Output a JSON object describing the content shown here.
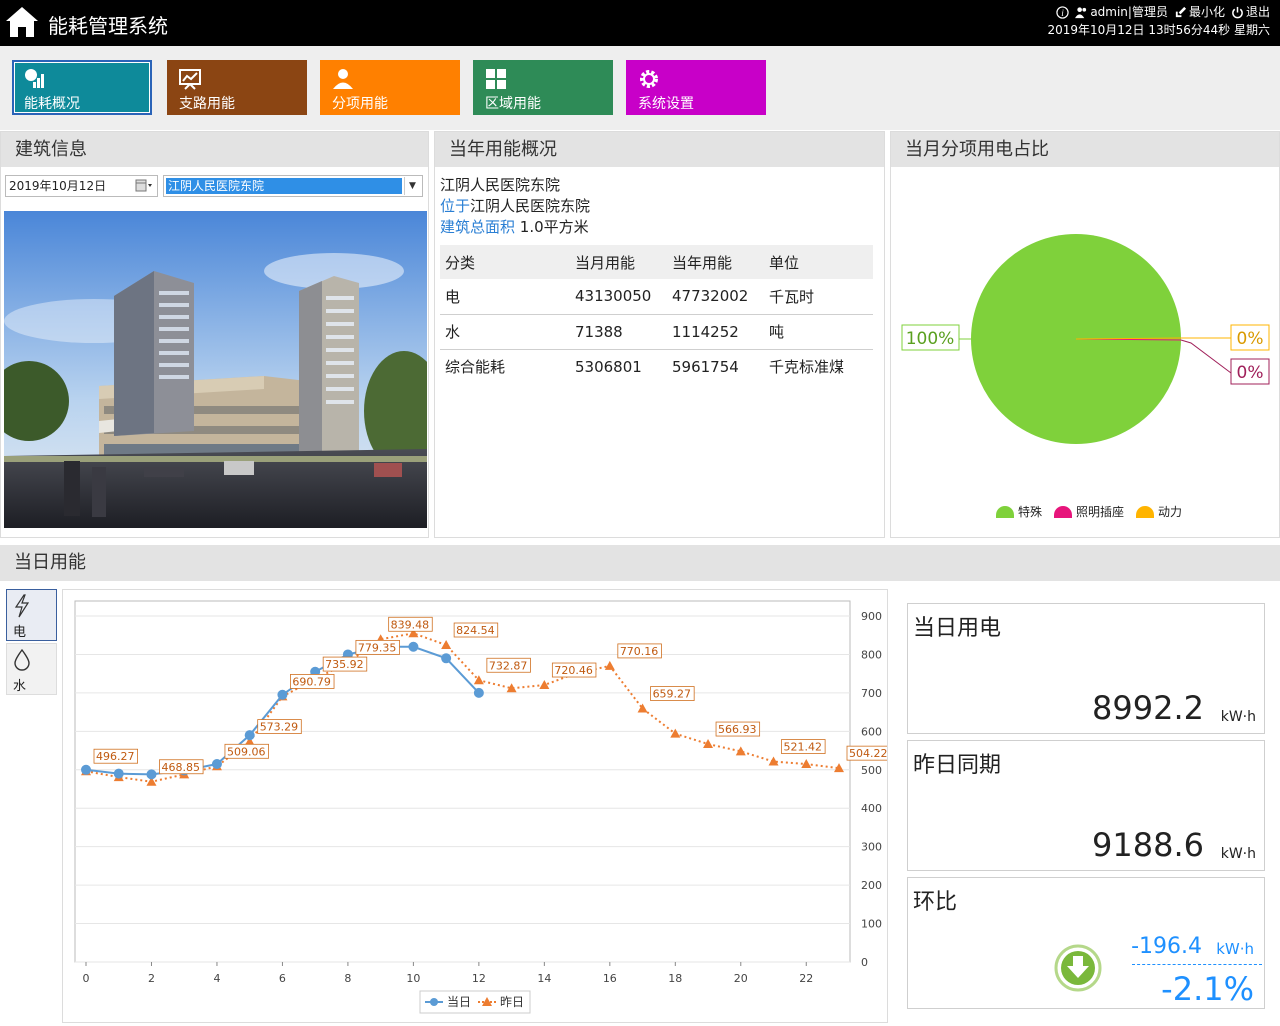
{
  "header": {
    "title": "能耗管理系统",
    "user": "admin|管理员",
    "minimize": "最小化",
    "logout": "退出",
    "datetime": "2019年10月12日 13时56分44秒 星期六"
  },
  "nav": [
    {
      "label": "能耗概况",
      "color": "#0e8a9a",
      "icon": "overview-icon"
    },
    {
      "label": "支路用能",
      "color": "#8b4513",
      "icon": "trend-chart-icon"
    },
    {
      "label": "分项用能",
      "color": "#ff8000",
      "icon": "person-icon"
    },
    {
      "label": "区域用能",
      "color": "#2e8b57",
      "icon": "grid-icon"
    },
    {
      "label": "系统设置",
      "color": "#c800c8",
      "icon": "gear-icon"
    }
  ],
  "building_info": {
    "title": "建筑信息",
    "date": "2019年10月12日",
    "building_selected": "江阴人民医院东院"
  },
  "annual": {
    "title": "当年用能概况",
    "name": "江阴人民医院东院",
    "location_label": "位于",
    "location": "江阴人民医院东院",
    "area_label": "建筑总面积",
    "area": "1.0平方米",
    "headers": [
      "分类",
      "当月用能",
      "当年用能",
      "单位"
    ],
    "rows": [
      [
        "电",
        "43130050",
        "47732002",
        "千瓦时"
      ],
      [
        "水",
        "71388",
        "1114252",
        "吨"
      ],
      [
        "综合能耗",
        "5306801",
        "5961754",
        "千克标准煤"
      ]
    ]
  },
  "pie": {
    "title": "当月分项用电占比",
    "slices": [
      {
        "name": "特殊",
        "percent": 100,
        "label": "100%",
        "color": "#7fd13b"
      },
      {
        "name": "照明插座",
        "percent": 0,
        "label": "0%",
        "color": "#e7157b"
      },
      {
        "name": "动力",
        "percent": 0,
        "label": "0%",
        "color": "#ffb400"
      }
    ]
  },
  "daily": {
    "title": "当日用能",
    "tabs": [
      {
        "label": "电",
        "icon": "lightning-icon"
      },
      {
        "label": "水",
        "icon": "water-drop-icon"
      }
    ],
    "stats": {
      "today_label": "当日用电",
      "today_value": "8992.2",
      "yesterday_label": "昨日同期",
      "yesterday_value": "9188.6",
      "unit": "kW·h",
      "ratio_label": "环比",
      "ratio_abs": "-196.4",
      "ratio_pct": "-2.1%"
    }
  },
  "chart_data": {
    "type": "line",
    "xlim": [
      0,
      23
    ],
    "ylim": [
      0,
      900
    ],
    "x_ticks": [
      0,
      2,
      4,
      6,
      8,
      10,
      12,
      14,
      16,
      18,
      20,
      22
    ],
    "y_ticks": [
      0,
      100,
      200,
      300,
      400,
      500,
      600,
      700,
      800,
      900
    ],
    "series": [
      {
        "name": "当日",
        "color": "#5b9bd5",
        "x": [
          0,
          1,
          2,
          3,
          4,
          5,
          6,
          7,
          8,
          9,
          10,
          11,
          12
        ],
        "values": [
          500,
          490,
          488,
          498,
          515,
          590,
          695,
          755,
          800,
          820,
          820,
          790,
          700
        ]
      },
      {
        "name": "昨日",
        "color": "#ed7d31",
        "x": [
          0,
          1,
          2,
          3,
          4,
          5,
          6,
          7,
          8,
          9,
          10,
          11,
          12,
          13,
          14,
          15,
          16,
          17,
          18,
          19,
          20,
          21,
          22,
          23
        ],
        "values": [
          496.27,
          481,
          468.85,
          488,
          509.06,
          573.29,
          690.79,
          735.92,
          779.35,
          839.48,
          855,
          824.54,
          732.87,
          712,
          720.46,
          752,
          770.16,
          659.27,
          594,
          566.93,
          548,
          521.42,
          515,
          504.22
        ]
      }
    ],
    "data_labels": [
      "496.27",
      "468.85",
      "509.06",
      "573.29",
      "690.79",
      "735.92",
      "779.35",
      "839.48",
      "824.54",
      "732.87",
      "720.46",
      "770.16",
      "659.27",
      "566.93",
      "521.42",
      "504.22"
    ]
  }
}
